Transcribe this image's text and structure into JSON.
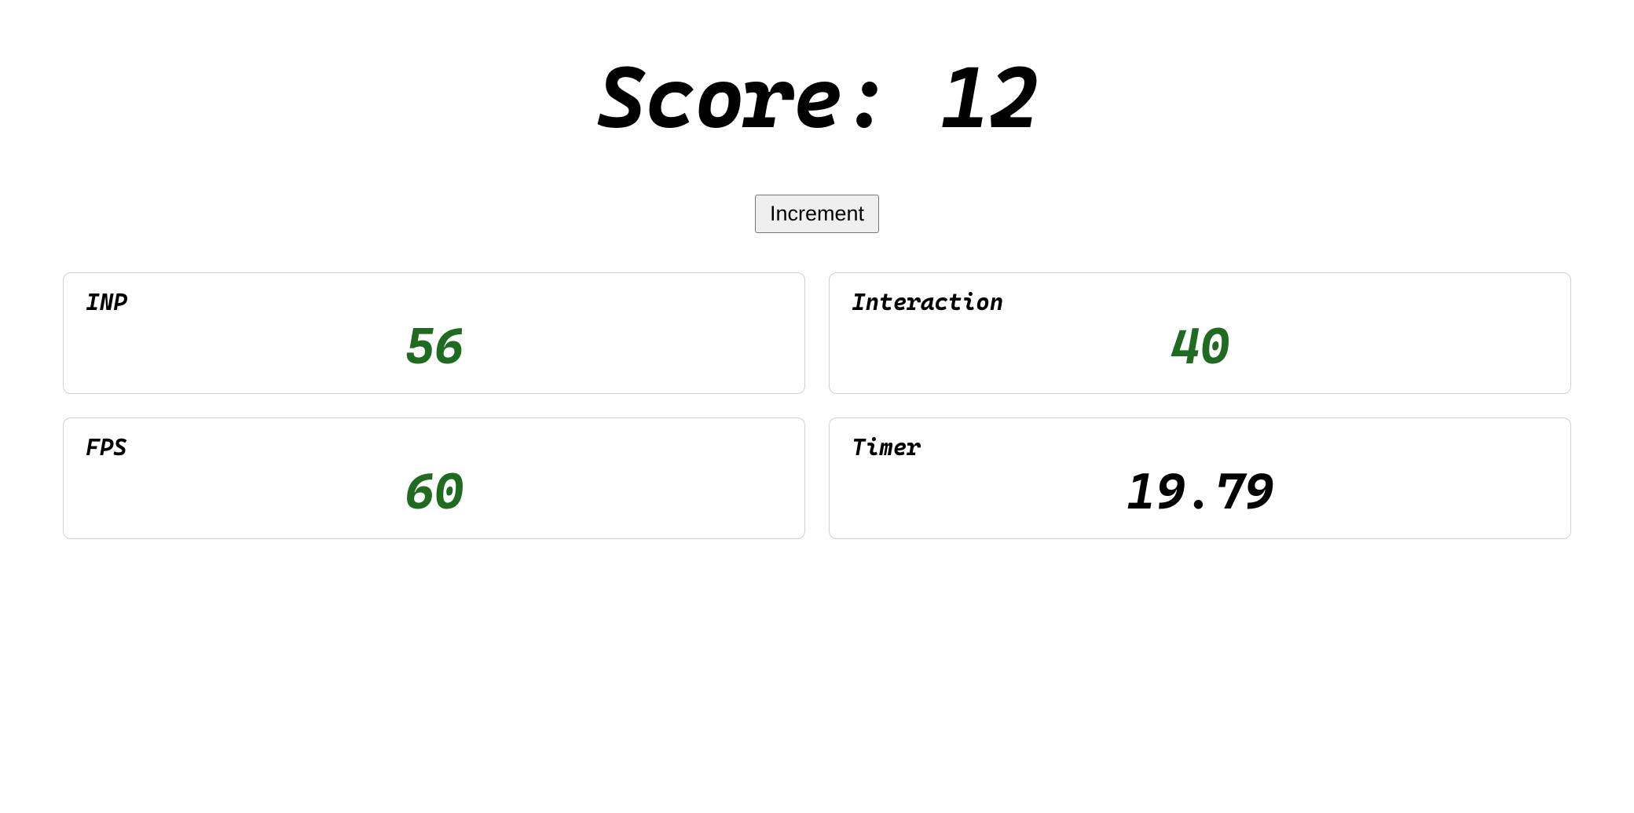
{
  "score": {
    "label": "Score:",
    "value": "12"
  },
  "button": {
    "increment": "Increment"
  },
  "metrics": {
    "inp": {
      "title": "INP",
      "value": "56"
    },
    "interaction": {
      "title": "Interaction",
      "value": "40"
    },
    "fps": {
      "title": "FPS",
      "value": "60"
    },
    "timer": {
      "title": "Timer",
      "value": "19.79"
    }
  }
}
